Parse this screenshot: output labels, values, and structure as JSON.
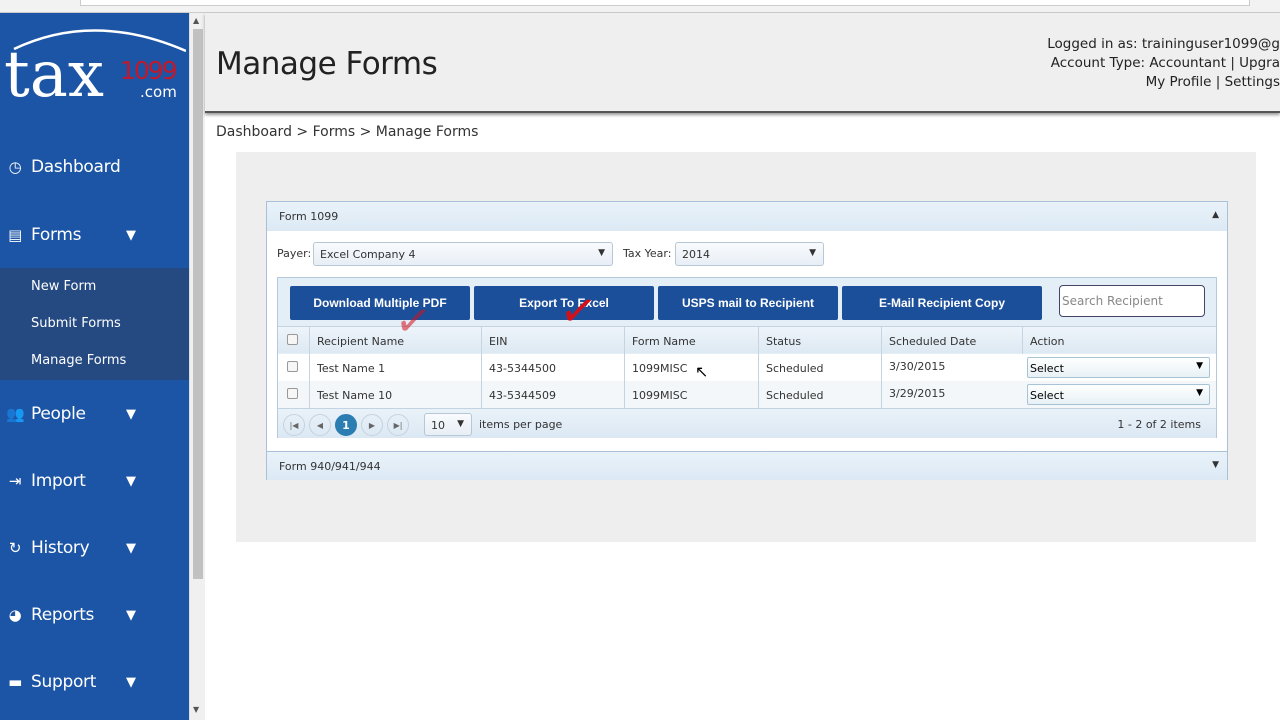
{
  "logo": {
    "text": "tax",
    "num": "1099",
    "domain": ".com"
  },
  "sidebar": {
    "items": [
      {
        "label": "Dashboard",
        "icon": "dashboard-icon"
      },
      {
        "label": "Forms",
        "icon": "forms-icon"
      },
      {
        "label": "People",
        "icon": "people-icon"
      },
      {
        "label": "Import",
        "icon": "import-icon"
      },
      {
        "label": "History",
        "icon": "history-icon"
      },
      {
        "label": "Reports",
        "icon": "reports-icon"
      },
      {
        "label": "Support",
        "icon": "support-icon"
      }
    ],
    "forms_sub": [
      "New Form",
      "Submit Forms",
      "Manage Forms"
    ]
  },
  "header": {
    "title": "Manage Forms",
    "logged_in": "Logged in as: traininguser1099@g",
    "account_type": "Account Type: Accountant | Upgra",
    "links": "My Profile | Settings"
  },
  "breadcrumb": "Dashboard > Forms > Manage Forms",
  "form1099": {
    "title": "Form 1099",
    "payer_label": "Payer:",
    "payer": "Excel Company 4",
    "year_label": "Tax Year:",
    "year": "2014",
    "buttons": [
      "Download Multiple PDF",
      "Export To Excel",
      "USPS mail to Recipient",
      "E-Mail Recipient Copy"
    ],
    "search_placeholder": "Search Recipient",
    "columns": [
      "Recipient Name",
      "EIN",
      "Form Name",
      "Status",
      "Scheduled Date",
      "Action"
    ],
    "rows": [
      {
        "name": "Test Name 1",
        "ein": "43-5344500",
        "form": "1099MISC",
        "status": "Scheduled",
        "date": "3/30/2015",
        "action": "Select"
      },
      {
        "name": "Test Name 10",
        "ein": "43-5344509",
        "form": "1099MISC",
        "status": "Scheduled",
        "date": "3/29/2015",
        "action": "Select"
      }
    ],
    "pager": {
      "current": "1",
      "page_size": "10",
      "per_page_label": "items per page",
      "summary": "1 - 2 of 2 items"
    }
  },
  "form940": {
    "title": "Form 940/941/944"
  },
  "colors": {
    "sidebar": "#1c55a5",
    "button": "#1b4f9a",
    "logo_red": "#c0182c"
  }
}
